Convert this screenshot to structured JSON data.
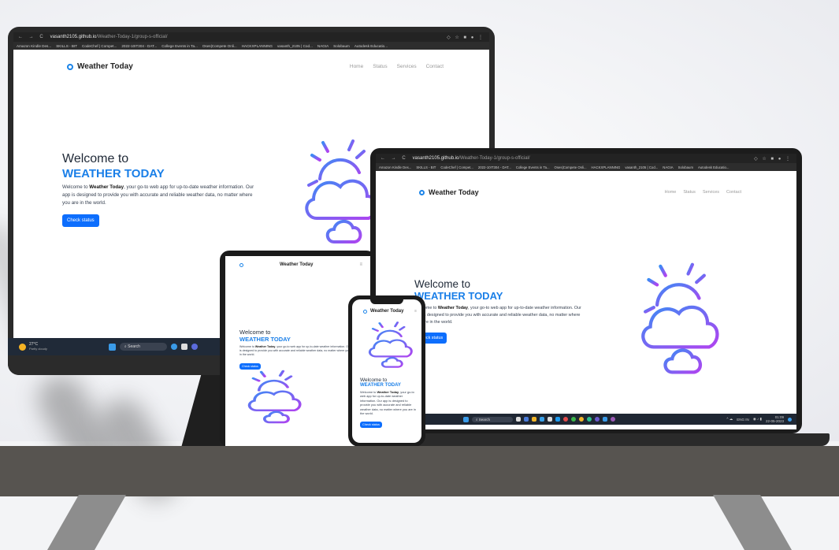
{
  "site": {
    "brand": "Weather Today",
    "nav_links": [
      "Home",
      "Status",
      "Services",
      "Contact"
    ],
    "welcome_line1": "Welcome to",
    "welcome_line2": "WEATHER TODAY",
    "desc_prefix": "Welcome to ",
    "desc_bold": "Weather Today",
    "desc_suffix": ", your go-to web app for up-to-date weather information. Our app is designed to provide you with accurate and reliable weather data, no matter where you are in the world.",
    "button_label": "Check status",
    "button_label_alt": "Check status"
  },
  "browser": {
    "url_host": "vasanth2105.github.io",
    "url_path": "/Weather-Today-1/group-s-official/",
    "bookmarks": [
      "Amazon Kindle Des...",
      "SKILLS - BIT",
      "CodeChef | Compet...",
      "2022-10IT304 - DAT...",
      "College Events in Ta...",
      "Oses|Compete Onli...",
      "HACKXPLANNING",
      "vasanth_2105 | Cod...",
      "NAGIA",
      "Solobaum",
      "Autodesk Educatio..."
    ]
  },
  "monitor_taskbar": {
    "weather_temp": "27°C",
    "weather_desc": "Partly cloudy",
    "search_label": "Search"
  },
  "laptop_taskbar": {
    "search_label": "Search",
    "lang": "ENG IN",
    "time": "01:09",
    "date": "22-05-2023"
  },
  "colors": {
    "accent": "#1a7fe8",
    "button": "#0d6efd",
    "sun_gradient_start": "#3b8bf5",
    "cloud_gradient_end": "#b043f0"
  }
}
